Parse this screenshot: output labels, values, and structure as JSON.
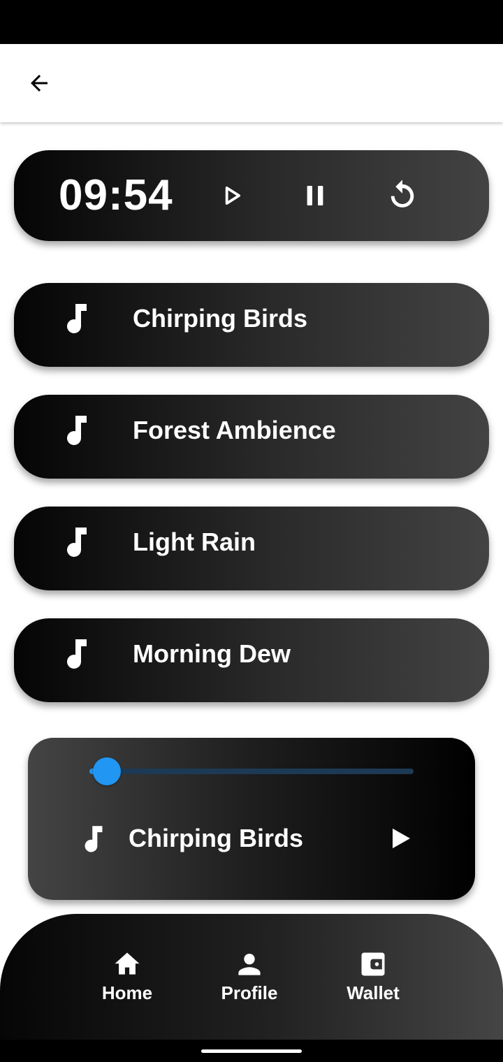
{
  "app_bar": {
    "back_icon": "arrow-left-icon"
  },
  "timer": {
    "display": "09:54",
    "play_icon": "play-outline-icon",
    "pause_icon": "pause-icon",
    "reset_icon": "restart-icon"
  },
  "sounds": [
    {
      "label": "Chirping Birds",
      "icon": "music-note-icon"
    },
    {
      "label": "Forest Ambience",
      "icon": "music-note-icon"
    },
    {
      "label": "Light Rain",
      "icon": "music-note-icon"
    },
    {
      "label": "Morning Dew",
      "icon": "music-note-icon"
    }
  ],
  "player": {
    "title": "Chirping Birds",
    "progress": 0.05,
    "note_icon": "music-note-icon",
    "play_icon": "play-icon"
  },
  "bottom_nav": {
    "items": [
      {
        "label": "Home",
        "icon": "home-icon"
      },
      {
        "label": "Profile",
        "icon": "person-icon"
      },
      {
        "label": "Wallet",
        "icon": "wallet-icon"
      }
    ]
  },
  "colors": {
    "accent": "#2196f3",
    "slider_track": "#1d3a55",
    "card_dark": "#050505",
    "card_light": "#434343"
  }
}
